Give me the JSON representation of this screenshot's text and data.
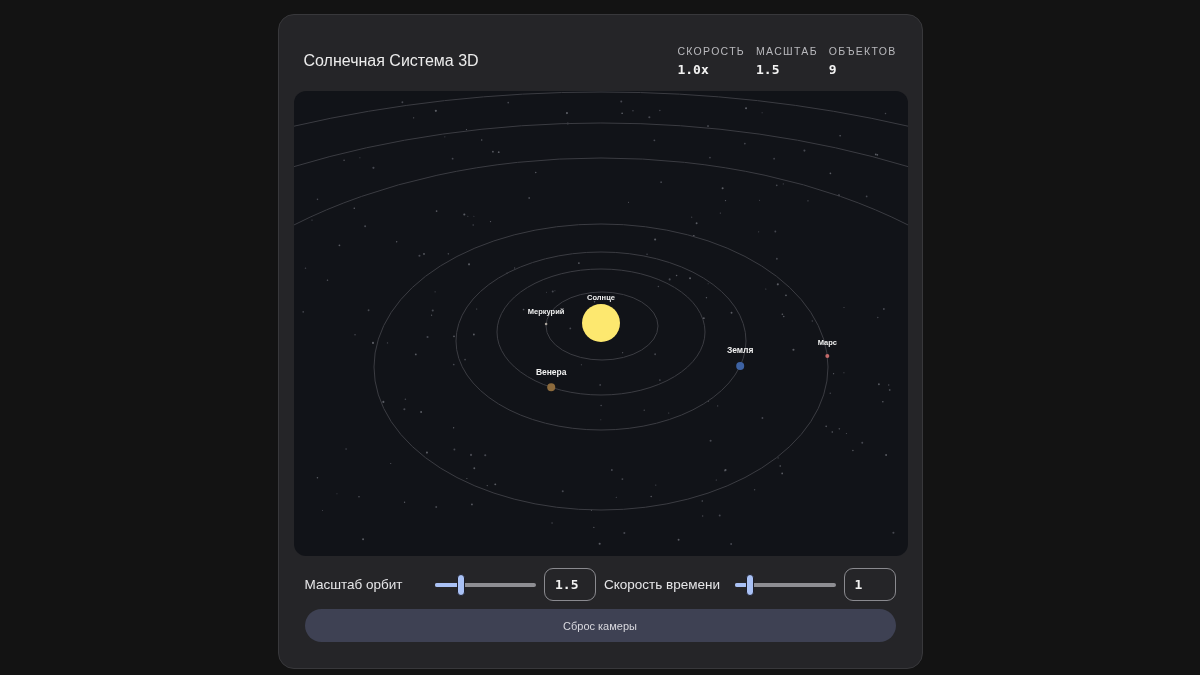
{
  "app": {
    "title": "Солнечная Система 3D"
  },
  "stats": [
    {
      "label": "СКОРОСТЬ",
      "value": "1.0x"
    },
    {
      "label": "МАСШТАБ",
      "value": "1.5"
    },
    {
      "label": "ОБЪЕКТОВ",
      "value": "9"
    }
  ],
  "scene": {
    "bodies": [
      {
        "kind": "star",
        "name": "Солнце",
        "color": "#fde86f"
      },
      {
        "kind": "planet",
        "name": "Меркурий",
        "color": "#a8a29a"
      },
      {
        "kind": "planet",
        "name": "Венера",
        "color": "#8c6a3c"
      },
      {
        "kind": "planet",
        "name": "Земля",
        "color": "#3d62a3"
      },
      {
        "kind": "planet",
        "name": "Марс",
        "color": "#c46a6a"
      }
    ]
  },
  "controls": [
    {
      "label": "Масштаб орбит",
      "level": 0.24,
      "value": "1.5"
    },
    {
      "label": "Скорость времени",
      "level": 0.12,
      "value": "1"
    }
  ],
  "reset_button": {
    "label": "Сброс камеры"
  }
}
